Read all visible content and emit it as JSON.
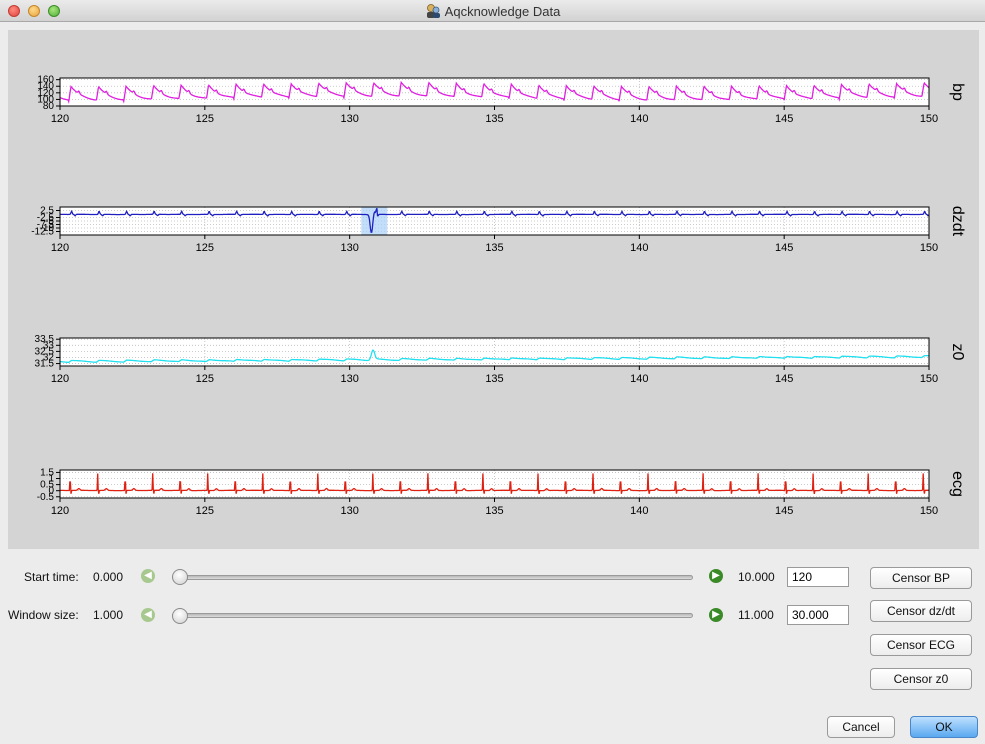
{
  "window": {
    "title": "Aqcknowledge Data"
  },
  "controls": {
    "start_time": {
      "label": "Start time:",
      "min_label": "0.000",
      "max_label": "10.000",
      "value": "120",
      "position": 0
    },
    "window_size": {
      "label": "Window size:",
      "min_label": "1.000",
      "max_label": "11.000",
      "value": "30.000",
      "position": 0
    }
  },
  "buttons": {
    "censor_bp": "Censor BP",
    "censor_dzdt": "Censor dz/dt",
    "censor_ecg": "Censor ECG",
    "censor_z0": "Censor z0",
    "cancel": "Cancel",
    "ok": "OK"
  },
  "chart_data": [
    {
      "type": "line",
      "name": "bp",
      "color": "#e020e0",
      "xlim": [
        120,
        150
      ],
      "xticks": [
        120,
        125,
        130,
        135,
        140,
        145,
        150
      ],
      "ylim": [
        80,
        165
      ],
      "yticks": [
        "160",
        "140",
        "120",
        "100",
        "80"
      ],
      "series": [
        {
          "name": "bp",
          "pattern": "arterial pressure waveform",
          "beat_period_s": 0.95,
          "systolic": 150,
          "diastolic": 100
        }
      ]
    },
    {
      "type": "line",
      "name": "dzdt",
      "color": "#2020c0",
      "xlim": [
        120,
        150
      ],
      "xticks": [
        120,
        125,
        130,
        135,
        140,
        145,
        150
      ],
      "ylim": [
        -15,
        5
      ],
      "yticks": [
        "2.5",
        "-2.5",
        "-5",
        "-7.5",
        "-10",
        "-12.5"
      ],
      "series": [
        {
          "name": "dzdt",
          "pattern": "impedance derivative with artifact near 130.8 s",
          "beat_period_s": 0.95
        }
      ],
      "highlight": [
        130.4,
        131.3
      ]
    },
    {
      "type": "line",
      "name": "z0",
      "color": "#20e0f0",
      "xlim": [
        120,
        150
      ],
      "xticks": [
        120,
        125,
        130,
        135,
        140,
        145,
        150
      ],
      "ylim": [
        31.3,
        33.6
      ],
      "yticks": [
        "33.5",
        "33",
        "32.5",
        "32",
        "31.5"
      ],
      "series": [
        {
          "name": "z0",
          "pattern": "slowly rising baseline with beat ripples",
          "start": 31.6,
          "end": 32.0
        }
      ]
    },
    {
      "type": "line",
      "name": "ecg",
      "color": "#e02010",
      "xlim": [
        120,
        150
      ],
      "xticks": [
        120,
        125,
        130,
        135,
        140,
        145,
        150
      ],
      "ylim": [
        -0.6,
        1.7
      ],
      "yticks": [
        "1.5",
        "1",
        "0.5",
        "0",
        "-0.5"
      ],
      "series": [
        {
          "name": "ecg",
          "pattern": "QRS spikes",
          "beat_period_s": 0.95,
          "r_peak": 1.4
        }
      ]
    }
  ]
}
